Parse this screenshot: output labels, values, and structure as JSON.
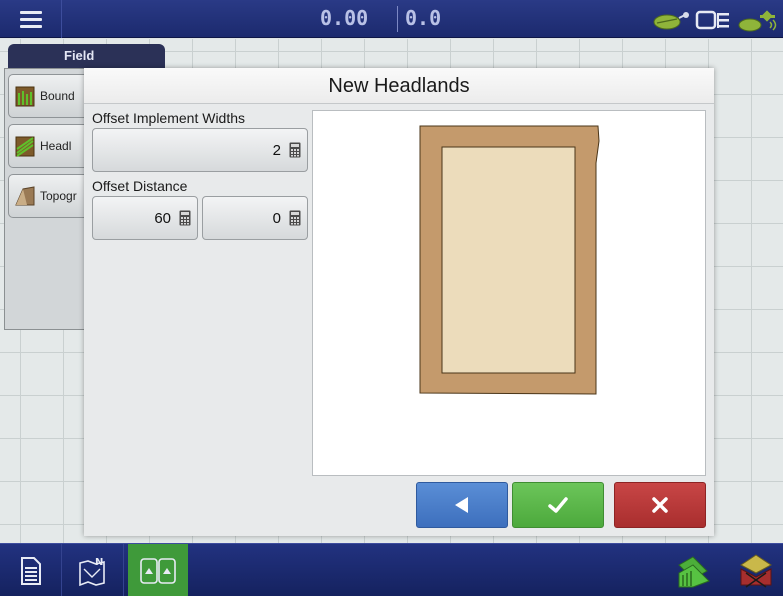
{
  "topbar": {
    "speed": "0.00",
    "area": "0.0",
    "icons": [
      "menu-icon",
      "gps-receiver-icon",
      "implement-icon",
      "rtk-signal-icon"
    ]
  },
  "field_panel": {
    "tab_label": "Field",
    "items": [
      {
        "label": "Bound",
        "icon": "boundary-icon"
      },
      {
        "label": "Headl",
        "icon": "headland-icon"
      },
      {
        "label": "Topogr",
        "icon": "topography-icon"
      }
    ]
  },
  "dialog": {
    "title": "New Headlands",
    "offset_widths_label": "Offset Implement Widths",
    "offset_widths_value": "2",
    "offset_distance_label": "Offset Distance",
    "offset_distance_major": "60",
    "offset_distance_minor": "0",
    "buttons": {
      "back": "back-arrow-icon",
      "accept": "checkmark-icon",
      "cancel": "close-x-icon"
    },
    "colors": {
      "back": "#4a7fcb",
      "accept": "#5cb84b",
      "cancel": "#b83636",
      "headland_band": "#c49a6c",
      "field_interior": "#ecdcbb"
    }
  },
  "bottombar": {
    "icons": [
      "report-icon",
      "map-north-icon",
      "split-view-icon",
      "field-layer-icon",
      "layer-disabled-icon"
    ]
  }
}
